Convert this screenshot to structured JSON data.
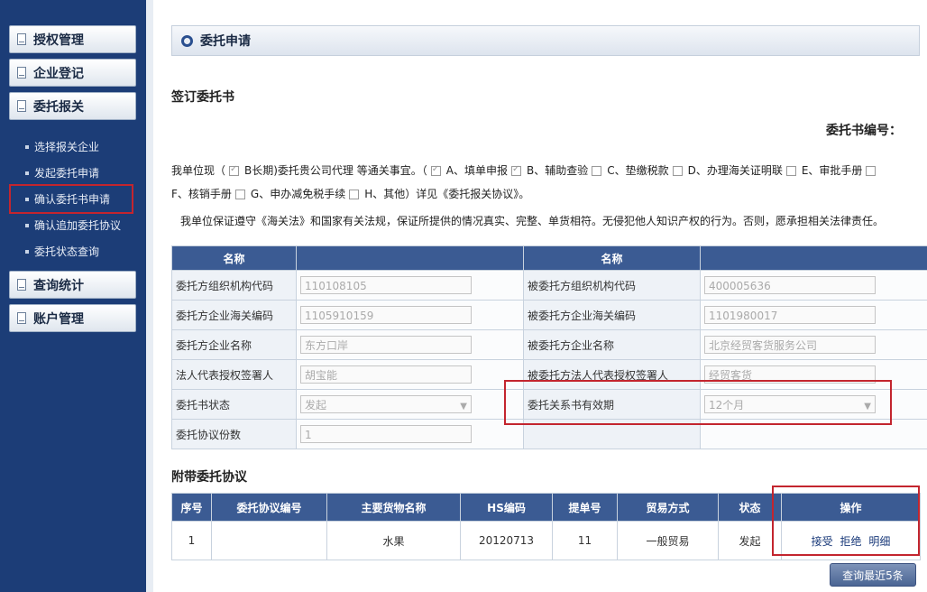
{
  "sidebar": {
    "buttons": [
      {
        "label": "授权管理"
      },
      {
        "label": "企业登记"
      },
      {
        "label": "委托报关"
      },
      {
        "label": "查询统计"
      },
      {
        "label": "账户管理"
      }
    ],
    "sub_items": [
      {
        "label": "选择报关企业"
      },
      {
        "label": "发起委托申请"
      },
      {
        "label": "确认委托书申请"
      },
      {
        "label": "确认追加委托协议"
      },
      {
        "label": "委托状态查询"
      }
    ]
  },
  "header": {
    "title": "委托申请"
  },
  "sign": {
    "title": "签订委托书",
    "doc_no_label": "委托书编号：",
    "line1_a": "我单位现（",
    "line1_b": "B长期)委托贵公司代理 等通关事宜。（",
    "opt_a": "A、填单申报",
    "opt_b": "B、辅助查验",
    "opt_c": "C、垫缴税款",
    "opt_d": "D、办理海关证明联",
    "opt_e": "E、审批手册",
    "opt_f": "F、核销手册",
    "opt_g": "G、申办减免税手续",
    "opt_h": "H、其他",
    "line2_tail": "）详见《委托报关协议》。",
    "line3": "我单位保证遵守《海关法》和国家有关法规，保证所提供的情况真实、完整、单货相符。无侵犯他人知识产权的行为。否则，愿承担相关法律责任。"
  },
  "info": {
    "col_name": "名称",
    "rows": [
      {
        "l_label": "委托方组织机构代码",
        "l_value": "110108105",
        "r_label": "被委托方组织机构代码",
        "r_value": "400005636"
      },
      {
        "l_label": "委托方企业海关编码",
        "l_value": "1105910159",
        "r_label": "被委托方企业海关编码",
        "r_value": "1101980017"
      },
      {
        "l_label": "委托方企业名称",
        "l_value": "东方口岸",
        "r_label": "被委托方企业名称",
        "r_value": "北京经贸客货服务公司"
      },
      {
        "l_label": "法人代表授权签署人",
        "l_value": "胡宝能",
        "r_label": "被委托方法人代表授权签署人",
        "r_value": "经贸客货"
      },
      {
        "l_label": "委托书状态",
        "l_value": "发起",
        "r_label": "委托关系书有效期",
        "r_value": "12个月"
      },
      {
        "l_label": "委托协议份数",
        "l_value": "1"
      }
    ]
  },
  "attach": {
    "title": "附带委托协议",
    "headers": [
      "序号",
      "委托协议编号",
      "主要货物名称",
      "HS编码",
      "提单号",
      "贸易方式",
      "状态",
      "操作"
    ],
    "row": {
      "no": "1",
      "code": "",
      "goods": "水果",
      "hs": "20120713",
      "bill": "11",
      "trade": "一般贸易",
      "status": "发起"
    },
    "ops": {
      "accept": "接受",
      "reject": "拒绝",
      "detail": "明细"
    }
  },
  "query_button": "查询最近5条",
  "colors": {
    "sidebar": "#1c3d77",
    "table_header": "#3b5b93",
    "highlight": "#c3252e"
  }
}
